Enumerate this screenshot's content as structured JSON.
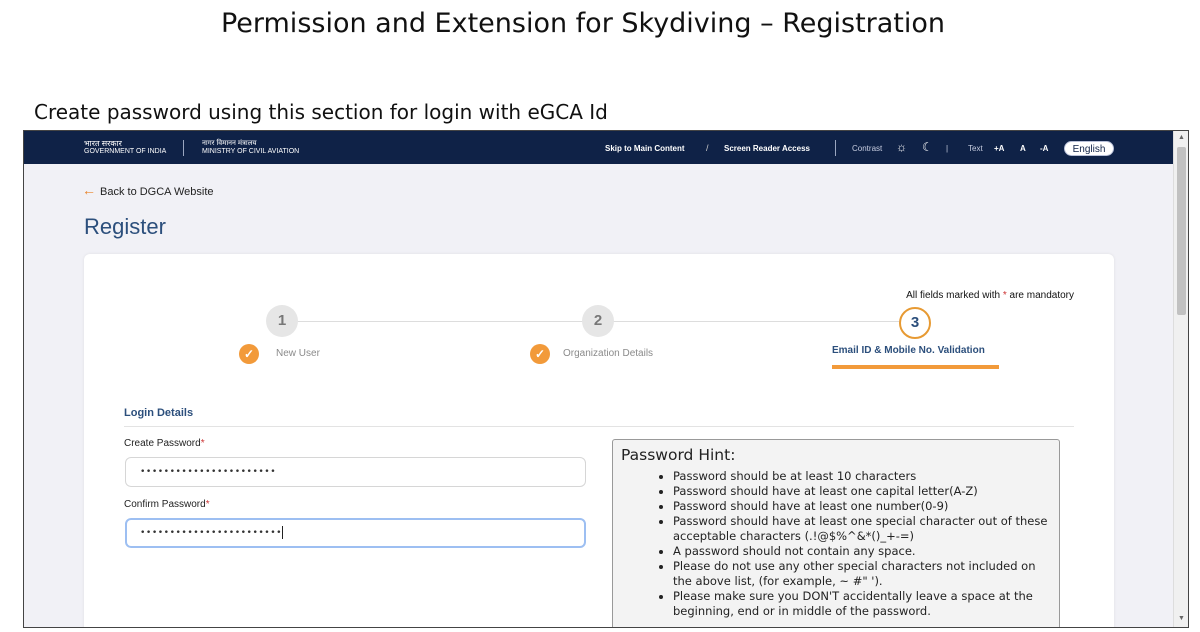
{
  "slide": {
    "title_part1": "Permission and Extension for Skydiving",
    "title_part2": " – Registration",
    "subtitle": "Create password using this section for login with eGCA Id"
  },
  "topbar": {
    "gov_hindi": "भारत सरकार",
    "gov_english": "GOVERNMENT OF INDIA",
    "ministry_hindi": "नागर विमानन मंत्रालय",
    "ministry_english": "MINISTRY OF CIVIL AVIATION",
    "skip_link": "Skip to Main Content",
    "slash": "/",
    "screen_reader": "Screen Reader Access",
    "contrast": "Contrast",
    "text_label": "Text",
    "text_large": "+A",
    "text_normal": "A",
    "text_small": "-A",
    "language": "English"
  },
  "page": {
    "back_link": "Back to DGCA Website",
    "heading": "Register"
  },
  "form": {
    "mandatory_note_pre": "All fields marked with ",
    "mandatory_star": "*",
    "mandatory_note_post": " are mandatory",
    "steps": [
      {
        "number": "1",
        "label": "New User",
        "done": true
      },
      {
        "number": "2",
        "label": "Organization Details",
        "done": true
      },
      {
        "number": "3",
        "label": "Email ID & Mobile No. Validation",
        "active": true
      }
    ],
    "check": "✓",
    "section_title": "Login Details",
    "create_password_label": "Create Password",
    "create_password_value": "•••••••••••••••••••••••",
    "confirm_password_label": "Confirm Password",
    "confirm_password_value": "••••••••••••••••••••••••",
    "required_star": "*"
  },
  "hint": {
    "title": "Password Hint:",
    "items": [
      "Password should be at least 10 characters",
      "Password should have at least one capital letter(A-Z)",
      "Password should have at least one number(0-9)",
      "Password should have at least one special character out of these acceptable characters (.!@$%^&*()_+-=)",
      "A password should not contain any space.",
      "Please do not use any other special characters not included on the above list, (for example, ~ #\" ').",
      "Please make sure you DON'T accidentally leave a space at the beginning, end or in middle of the password."
    ]
  },
  "colors": {
    "topbar": "#0f2247",
    "accent": "#f29a3a",
    "heading": "#2c4f7c"
  }
}
